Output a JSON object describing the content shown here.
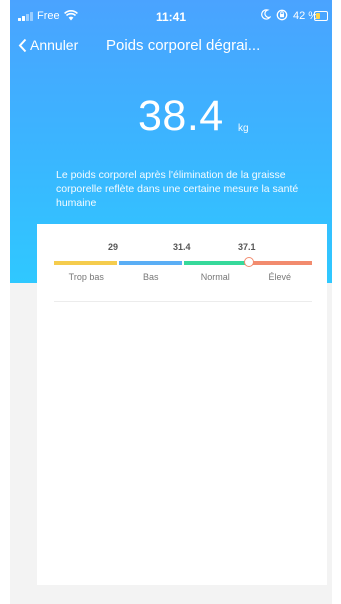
{
  "status_bar": {
    "carrier": "Free",
    "time": "11:41",
    "battery_percent": "42 %",
    "battery_level": 0.42,
    "icons": [
      "signal-icon",
      "wifi-icon",
      "moon-icon",
      "orientation-lock-icon",
      "battery-icon"
    ]
  },
  "nav": {
    "back_label": "Annuler",
    "title": "Poids corporel dégrai..."
  },
  "metric": {
    "value": "38.4",
    "unit": "kg",
    "description": "Le poids corporel après l'élimination de la graisse corporelle reflète dans une certaine mesure la santé humaine"
  },
  "scale": {
    "thresholds": [
      "29",
      "31.4",
      "37.1"
    ],
    "labels": [
      "Trop bas",
      "Bas",
      "Normal",
      "Élevé"
    ],
    "colors": [
      "#f5cc4d",
      "#5aaef5",
      "#36d99b",
      "#f28b6e"
    ],
    "marker_segment": 3,
    "marker_position_in_segment": 0.0
  }
}
